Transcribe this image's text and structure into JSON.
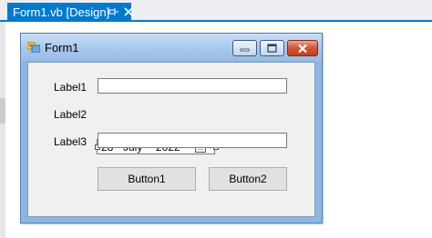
{
  "ide": {
    "tab_title": "Form1.vb [Design]",
    "pin_icon": "pin-icon",
    "close_icon": "close-icon",
    "accent_color": "#007acc"
  },
  "form": {
    "title": "Form1",
    "app_icon": "form-app-icon",
    "caption_buttons": [
      "minimize",
      "maximize",
      "close"
    ],
    "labels": {
      "label1": "Label1",
      "label2": "Label2",
      "label3": "Label3"
    },
    "textbox1_value": "",
    "textbox2_value": "",
    "datepicker": {
      "day": "28",
      "month": "July",
      "year": "2022"
    },
    "buttons": {
      "button1": "Button1",
      "button2": "Button2"
    }
  }
}
